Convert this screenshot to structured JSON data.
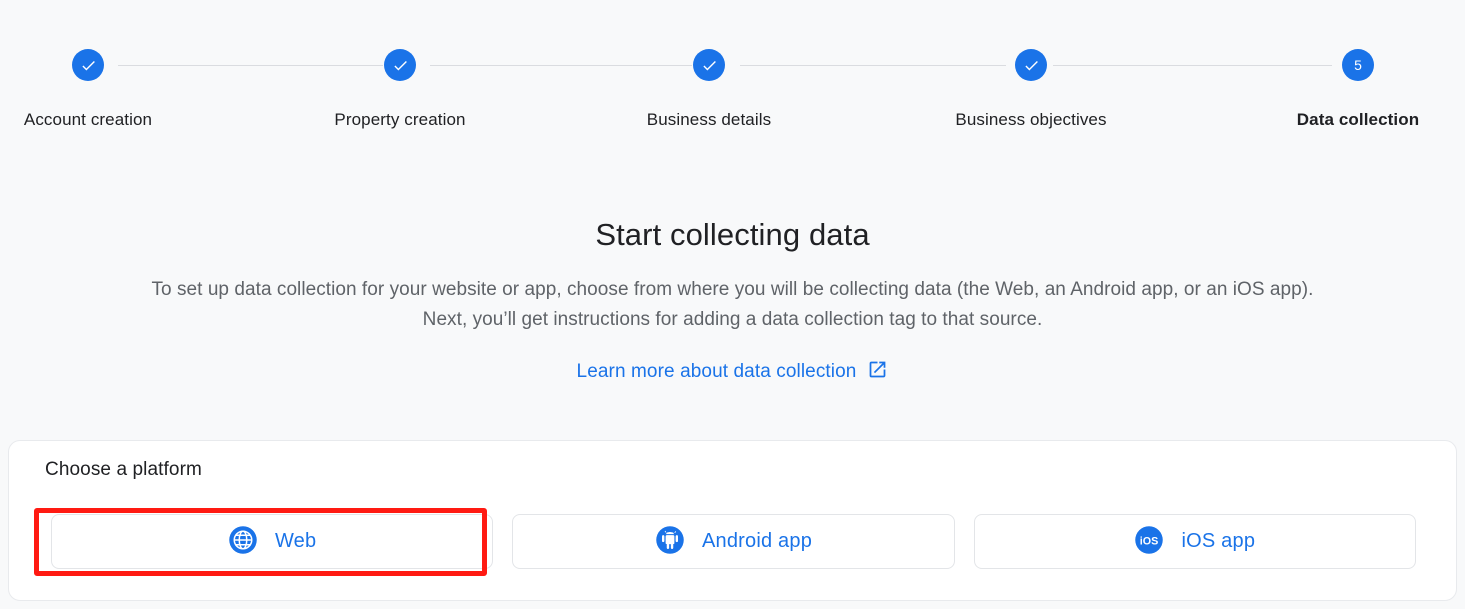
{
  "stepper": {
    "steps": [
      {
        "label": "Account creation",
        "state": "complete",
        "marker": "check"
      },
      {
        "label": "Property creation",
        "state": "complete",
        "marker": "check"
      },
      {
        "label": "Business details",
        "state": "complete",
        "marker": "check"
      },
      {
        "label": "Business objectives",
        "state": "complete",
        "marker": "check"
      },
      {
        "label": "Data collection",
        "state": "current",
        "marker": "5"
      }
    ],
    "accent_color": "#1a73e8",
    "connector_color": "#dadce0"
  },
  "hero": {
    "title": "Start collecting data",
    "description": "To set up data collection for your website or app, choose from where you will be collecting data (the Web, an Android app, or an iOS app). Next, you’ll get instructions for adding a data collection tag to that source.",
    "learn_more_label": "Learn more about data collection",
    "learn_more_icon": "open-in-new-icon",
    "link_color": "#1a73e8"
  },
  "platform_card": {
    "heading": "Choose a platform",
    "options": [
      {
        "label": "Web",
        "icon": "globe-icon",
        "selected": true
      },
      {
        "label": "Android app",
        "icon": "android-icon",
        "selected": false
      },
      {
        "label": "iOS app",
        "icon": "ios-icon",
        "selected": false
      }
    ]
  },
  "annotation": {
    "highlight_target": "Web",
    "highlight_color": "#ff1a12"
  }
}
